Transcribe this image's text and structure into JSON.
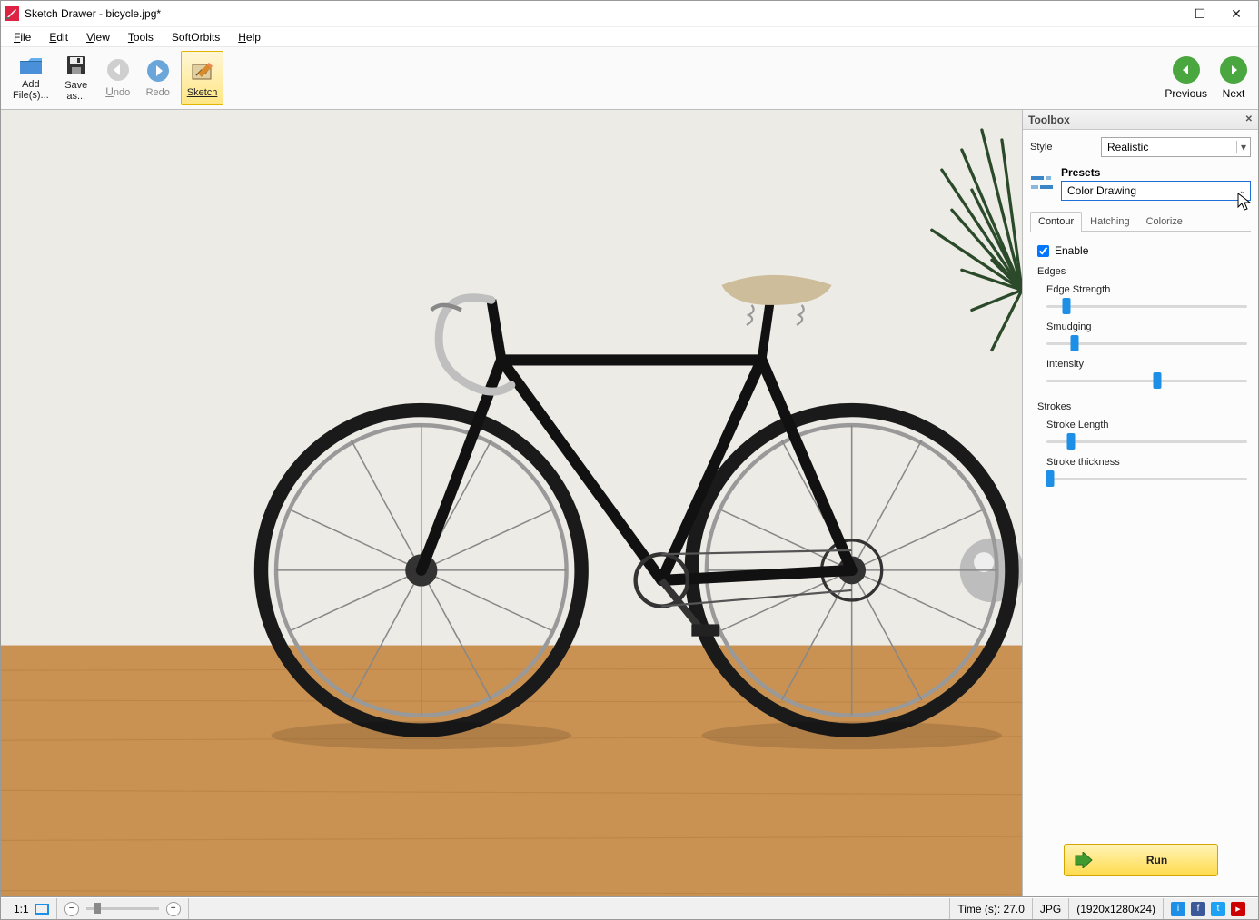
{
  "title": "Sketch Drawer - bicycle.jpg*",
  "menu": {
    "file": "File",
    "edit": "Edit",
    "view": "View",
    "tools": "Tools",
    "softorbits": "SoftOrbits",
    "help": "Help"
  },
  "toolbar": {
    "addFiles": "Add\nFile(s)...",
    "saveAs": "Save\nas...",
    "undo": "Undo",
    "redo": "Redo",
    "sketch": "Sketch",
    "previous": "Previous",
    "next": "Next"
  },
  "toolbox": {
    "title": "Toolbox",
    "styleLabel": "Style",
    "styleValue": "Realistic",
    "presetsLabel": "Presets",
    "presetValue": "Color Drawing",
    "tabs": {
      "contour": "Contour",
      "hatching": "Hatching",
      "colorize": "Colorize"
    },
    "enable": "Enable",
    "edges": {
      "title": "Edges",
      "strength": {
        "label": "Edge Strength",
        "value": 10
      },
      "smudging": {
        "label": "Smudging",
        "value": 14
      },
      "intensity": {
        "label": "Intensity",
        "value": 55
      }
    },
    "strokes": {
      "title": "Strokes",
      "length": {
        "label": "Stroke Length",
        "value": 12
      },
      "thickness": {
        "label": "Stroke thickness",
        "value": 2
      }
    },
    "run": "Run"
  },
  "status": {
    "ratio": "1:1",
    "time": "Time (s): 27.0",
    "format": "JPG",
    "dimensions": "(1920x1280x24)"
  }
}
